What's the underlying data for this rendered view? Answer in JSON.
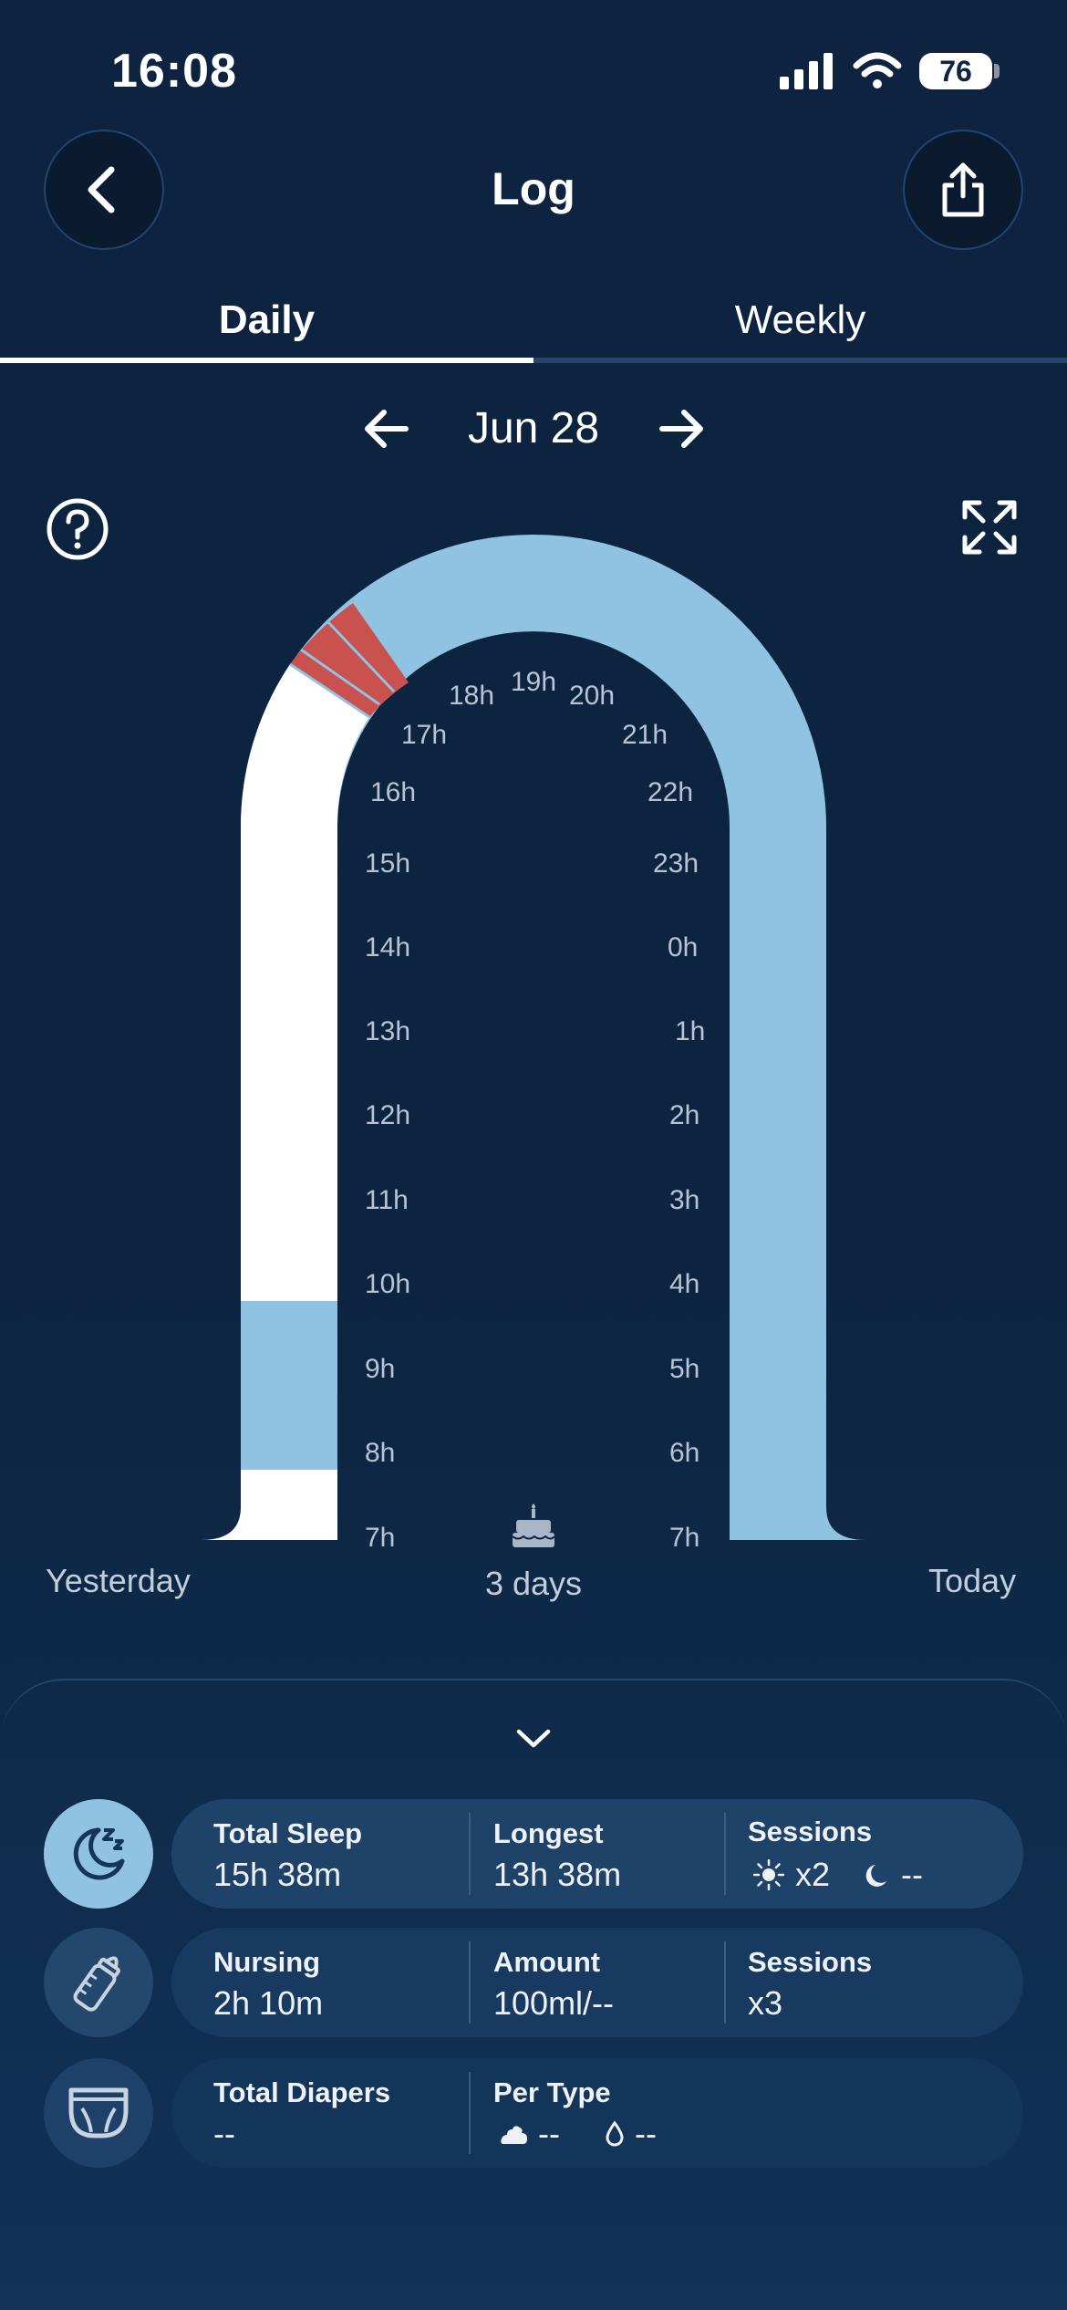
{
  "status_bar": {
    "time": "16:08",
    "battery": "76"
  },
  "header": {
    "title": "Log"
  },
  "tabs": [
    {
      "label": "Daily",
      "active": true
    },
    {
      "label": "Weekly",
      "active": false
    }
  ],
  "date_nav": {
    "date": "Jun 28"
  },
  "chart": {
    "left_hours": [
      "17h",
      "16h",
      "15h",
      "14h",
      "13h",
      "12h",
      "11h",
      "10h",
      "9h",
      "8h",
      "7h"
    ],
    "top_hours": [
      "18h",
      "19h",
      "20h"
    ],
    "right_hours": [
      "21h",
      "22h",
      "23h",
      "0h",
      "1h",
      "2h",
      "3h",
      "4h",
      "5h",
      "6h",
      "7h"
    ],
    "age": "3 days",
    "left_caption": "Yesterday",
    "right_caption": "Today",
    "colors": {
      "sleep": "#90c3e1",
      "awake": "#ffffff",
      "nursing": "#c9524f",
      "background": "#0d2340"
    }
  },
  "summary": {
    "sleep": {
      "icon": "moon-zzz-icon",
      "total_label": "Total Sleep",
      "total_value": "15h 38m",
      "longest_label": "Longest",
      "longest_value": "13h 38m",
      "sessions_label": "Sessions",
      "day_count": "x2",
      "night_count": "--"
    },
    "nursing": {
      "icon": "bottle-icon",
      "nursing_label": "Nursing",
      "nursing_value": "2h 10m",
      "amount_label": "Amount",
      "amount_value": "100ml/--",
      "sessions_label": "Sessions",
      "sessions_value": "x3"
    },
    "diapers": {
      "icon": "diaper-icon",
      "total_label": "Total Diapers",
      "total_value": "--",
      "per_type_label": "Per Type",
      "poop_value": "--",
      "pee_value": "--"
    }
  }
}
